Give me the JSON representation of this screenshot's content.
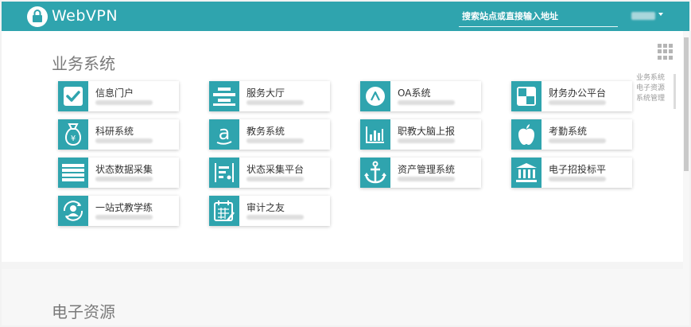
{
  "topbar": {
    "brand": "WebVPN",
    "search_placeholder": "搜索站点或直接输入地址",
    "accent": "#2fa4ae"
  },
  "section1": {
    "title": "业务系统"
  },
  "side_nav": [
    "业务系统",
    "电子资源",
    "系统管理"
  ],
  "apps": [
    {
      "name": "信息门户",
      "icon": "checkbox-icon"
    },
    {
      "name": "服务大厅",
      "icon": "align-icon"
    },
    {
      "name": "OA系统",
      "icon": "a-circle-icon"
    },
    {
      "name": "财务办公平台",
      "icon": "squares-icon"
    },
    {
      "name": "科研系统",
      "icon": "money-bag-icon"
    },
    {
      "name": "教务系统",
      "icon": "amazon-a-icon"
    },
    {
      "name": "职教大脑上报",
      "icon": "bar-chart-icon"
    },
    {
      "name": "考勤系统",
      "icon": "apple-icon"
    },
    {
      "name": "状态数据采集",
      "icon": "lines-icon"
    },
    {
      "name": "状态采集平台",
      "icon": "form-icon"
    },
    {
      "name": "资产管理系统",
      "icon": "anchor-icon"
    },
    {
      "name": "电子招投标平",
      "icon": "bank-icon"
    },
    {
      "name": "一站式教学练",
      "icon": "user-cycle-icon"
    },
    {
      "name": "审计之友",
      "icon": "calendar-icon"
    }
  ],
  "section2": {
    "title": "电子资源"
  }
}
